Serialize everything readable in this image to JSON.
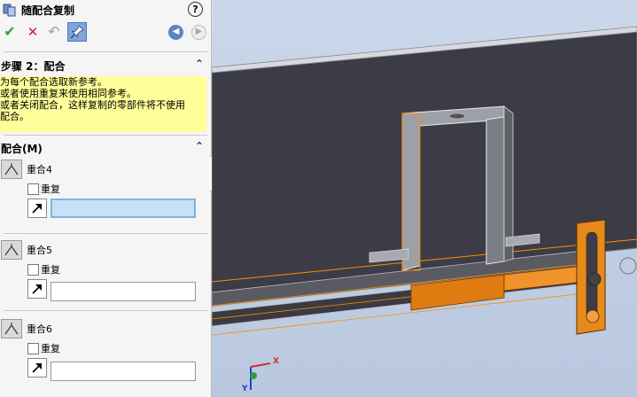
{
  "panel": {
    "title": "随配合复制",
    "help_label": "?",
    "toolbar": {
      "ok": "✔",
      "cancel": "✕",
      "undo": "↶",
      "pin": "📌",
      "back": "◀",
      "forward": "▶"
    },
    "step_section": {
      "title": "步骤 2：配合",
      "collapse": "⌃",
      "message_lines": [
        "为每个配合选取新参考。",
        "或者使用重复来使用相同参考。",
        "或者关闭配合，这样复制的零部件将不使用",
        "配合。"
      ]
    },
    "mates_section": {
      "title": "配合(M)",
      "collapse": "⌃",
      "items": [
        {
          "label": "重合4",
          "repeat_label": "重复",
          "selection_value": ""
        },
        {
          "label": "重合5",
          "repeat_label": "重复",
          "selection_value": ""
        },
        {
          "label": "重合6",
          "repeat_label": "重复",
          "selection_value": ""
        }
      ]
    }
  },
  "viewport": {
    "triad": {
      "x_label": "X",
      "y_label": "Y"
    }
  },
  "colors": {
    "highlight": "#ff8c00",
    "part_dark": "#3b3b45",
    "part_gray": "#8e8e95",
    "background": "#c2d0e6"
  }
}
